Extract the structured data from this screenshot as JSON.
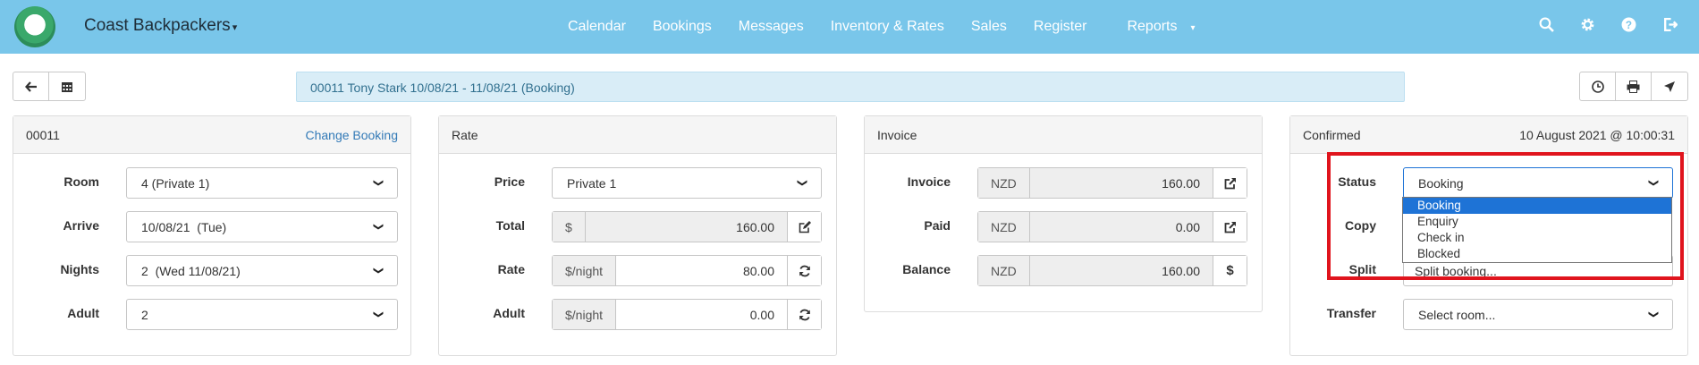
{
  "navbar": {
    "brand": "Coast Backpackers",
    "links": [
      "Calendar",
      "Bookings",
      "Messages",
      "Inventory & Rates",
      "Sales",
      "Register",
      "Reports"
    ],
    "icons": [
      "search-icon",
      "gear-icon",
      "help-icon",
      "logout-icon"
    ]
  },
  "toolbar": {
    "info": "00011  Tony Stark  10/08/21 - 11/08/21  (Booking)"
  },
  "booking_panel": {
    "id": "00011",
    "change_link": "Change Booking",
    "room_label": "Room",
    "room_value": "4 (Private 1)",
    "arrive_label": "Arrive",
    "arrive_value": "10/08/21  (Tue)",
    "nights_label": "Nights",
    "nights_value": "2  (Wed 11/08/21)",
    "adult_label": "Adult",
    "adult_value": "2"
  },
  "rate_panel": {
    "title": "Rate",
    "price_label": "Price",
    "price_value": "Private 1",
    "total_label": "Total",
    "total_addon": "$",
    "total_value": "160.00",
    "rate_label": "Rate",
    "rate_addon": "$/night",
    "rate_value": "80.00",
    "adult_label": "Adult",
    "adult_addon": "$/night",
    "adult_value": "0.00"
  },
  "invoice_panel": {
    "title": "Invoice",
    "invoice_label": "Invoice",
    "invoice_currency": "NZD",
    "invoice_value": "160.00",
    "paid_label": "Paid",
    "paid_currency": "NZD",
    "paid_value": "0.00",
    "balance_label": "Balance",
    "balance_currency": "NZD",
    "balance_value": "160.00",
    "balance_btn": "$"
  },
  "status_panel": {
    "title": "Confirmed",
    "timestamp": "10 August 2021 @ 10:00:31",
    "status_label": "Status",
    "status_value": "Booking",
    "copy_label": "Copy",
    "split_label": "Split",
    "split_value": "Split booking...",
    "transfer_label": "Transfer",
    "transfer_placeholder": "Select room...",
    "status_options": [
      "Booking",
      "Enquiry",
      "Check in",
      "Blocked"
    ]
  },
  "colors": {
    "navbar": "#79c6ea",
    "info_bg": "#d9edf7",
    "highlight": "#e0141d",
    "selected_option": "#1e73d6"
  }
}
